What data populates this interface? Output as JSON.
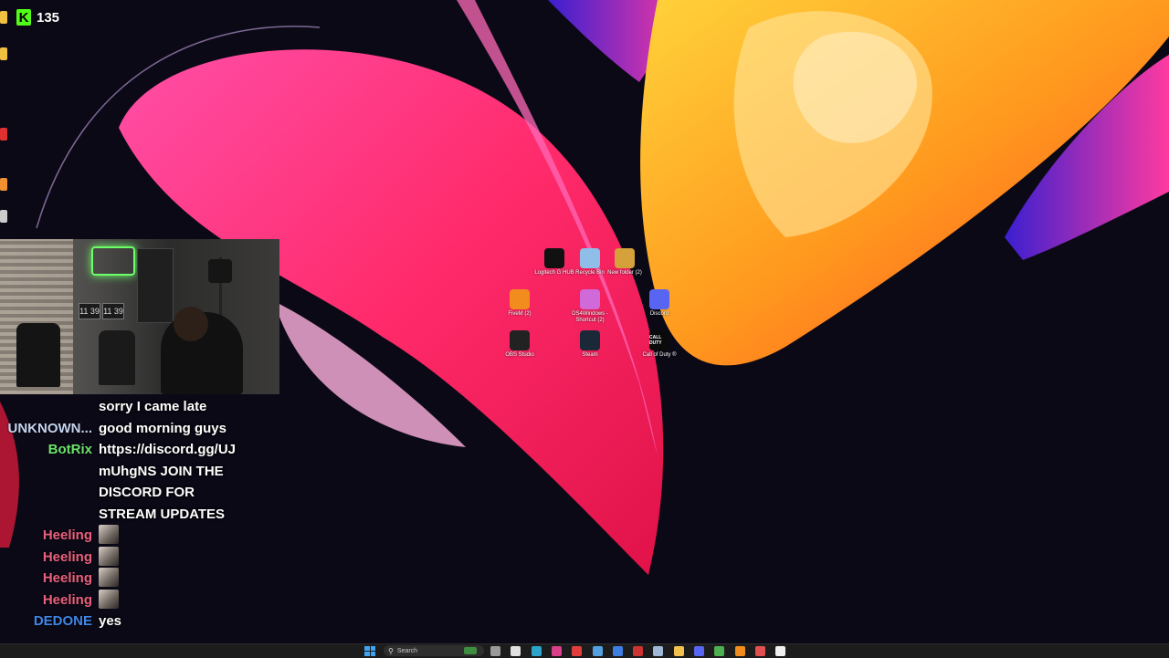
{
  "stream_overlay": {
    "platform_icon": "kick-logo",
    "viewer_count": "135"
  },
  "desktop_icons": [
    {
      "label": "Logitech G HUB",
      "icon": "logitech-g-icon",
      "color": "#111111"
    },
    {
      "label": "Recycle Bin",
      "icon": "recycle-bin-icon",
      "color": "#8fbfe8"
    },
    {
      "label": "New folder (2)",
      "icon": "folder-icon",
      "color": "#d4a13a"
    },
    {
      "label": "FiveM (2)",
      "icon": "fivem-icon",
      "color": "#f28c1e"
    },
    {
      "label": "DS4Windows - Shortcut (2)",
      "icon": "ds4windows-icon",
      "color": "#d06ad8"
    },
    {
      "label": "Discord",
      "icon": "discord-icon",
      "color": "#5865f2"
    },
    {
      "label": "OBS Studio",
      "icon": "obs-icon",
      "color": "#222222"
    },
    {
      "label": "Steam",
      "icon": "steam-icon",
      "color": "#1b2838"
    },
    {
      "label": "Call of Duty ®",
      "icon": "call-of-duty-icon",
      "color": "#0a0a0a",
      "glyph_text": "CALL DUTY"
    }
  ],
  "chat": {
    "messages": [
      {
        "user": "",
        "user_color": "#ffffff",
        "text": "sorry I came late",
        "emote": false
      },
      {
        "user": "UNKNOWN...",
        "user_color": "#c4d4ee",
        "text": "good morning guys",
        "emote": false
      },
      {
        "user": "BotRix",
        "user_color": "#6be36b",
        "text": "https://discord.gg/UJ mUhgNS JOIN THE DISCORD FOR STREAM UPDATES",
        "emote": false
      },
      {
        "user": "Heeling",
        "user_color": "#e9607d",
        "text": "",
        "emote": true
      },
      {
        "user": "Heeling",
        "user_color": "#e9607d",
        "text": "",
        "emote": true
      },
      {
        "user": "Heeling",
        "user_color": "#e9607d",
        "text": "",
        "emote": true
      },
      {
        "user": "Heeling",
        "user_color": "#e9607d",
        "text": "",
        "emote": true
      },
      {
        "user": "DEDONE",
        "user_color": "#3f86e6",
        "text": "yes",
        "emote": false
      }
    ]
  },
  "webcam": {
    "monitor_clock_1": "11 39",
    "monitor_clock_2": "11 39"
  },
  "taskbar": {
    "search_placeholder": "Search",
    "apps": [
      {
        "name": "task-view-icon",
        "color": "#9a9a9a"
      },
      {
        "name": "chrome-icon",
        "color": "#e0e0e0"
      },
      {
        "name": "edge-icon",
        "color": "#2aa5c9"
      },
      {
        "name": "instagram-icon",
        "color": "#d8408a"
      },
      {
        "name": "red-app-icon",
        "color": "#e23d3d"
      },
      {
        "name": "network-app-icon",
        "color": "#52a0e0"
      },
      {
        "name": "blue-app-icon",
        "color": "#3c7fe0"
      },
      {
        "name": "app-icon",
        "color": "#cc3333"
      },
      {
        "name": "steam-icon",
        "color": "#9fb8d8"
      },
      {
        "name": "file-explorer-icon",
        "color": "#f2c14e"
      },
      {
        "name": "discord-icon",
        "color": "#5865f2"
      },
      {
        "name": "chrome-icon",
        "color": "#4caf50"
      },
      {
        "name": "orange-app-icon",
        "color": "#f28c1e"
      },
      {
        "name": "browser-icon",
        "color": "#e05050"
      },
      {
        "name": "notepad-icon",
        "color": "#f0f0f0"
      }
    ]
  }
}
